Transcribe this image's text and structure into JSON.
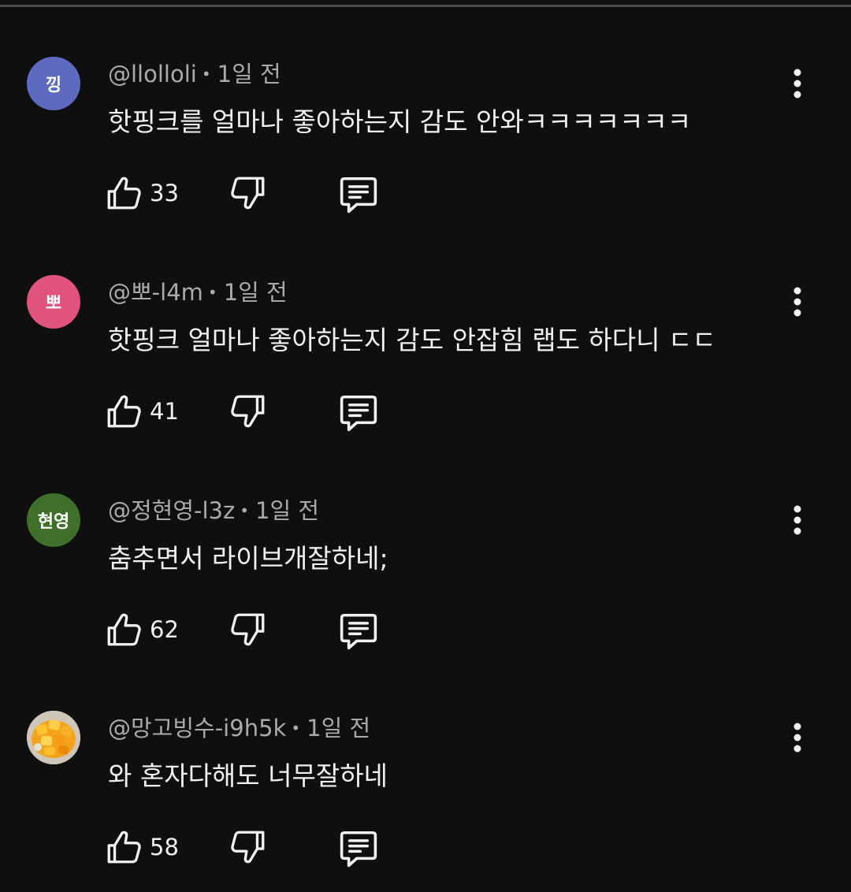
{
  "comments": [
    {
      "avatar_text": "낑",
      "avatar_color": "#5c6bc0",
      "handle": "@llolloli",
      "time": "1일 전",
      "text": "핫핑크를 얼마나 좋아하는지 감도 안와ㅋㅋㅋㅋㅋㅋㅋ",
      "likes": "33"
    },
    {
      "avatar_text": "뽀",
      "avatar_color": "#e0537e",
      "handle": "@뽀-l4m",
      "time": "1일 전",
      "text": "핫핑크 얼마나 좋아하는지 감도 안잡힘 랩도 하다니 ㄷㄷ",
      "likes": "41"
    },
    {
      "avatar_text": "현영",
      "avatar_color": "#3f6f2a",
      "handle": "@정현영-l3z",
      "time": "1일 전",
      "text": "춤추면서 라이브개잘하네;",
      "likes": "62"
    },
    {
      "avatar_text": "",
      "avatar_color": "#f5a623",
      "avatar_icon": "mango-photo-avatar",
      "handle": "@망고빙수-i9h5k",
      "time": "1일 전",
      "text": "와 혼자다해도 너무잘하네",
      "likes": "58"
    }
  ],
  "icons": {
    "like": "thumbs-up-icon",
    "dislike": "thumbs-down-icon",
    "reply": "reply-comment-icon",
    "more": "more-vertical-icon"
  }
}
